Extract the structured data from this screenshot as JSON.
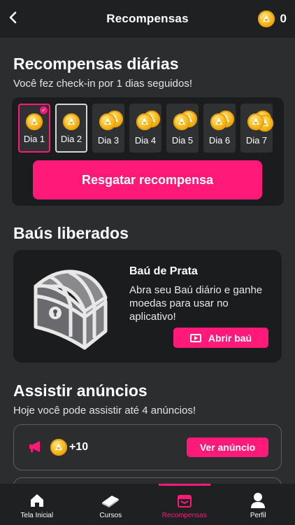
{
  "header": {
    "back_icon": "chevron-left-icon",
    "title": "Recompensas",
    "coin_count": "0"
  },
  "daily": {
    "title": "Recompensas diárias",
    "subtitle": "Você fez check-in por 1 dias seguidos!",
    "days": [
      {
        "label": "Dia 1",
        "state": "checked"
      },
      {
        "label": "Dia 2",
        "state": "current"
      },
      {
        "label": "Dia 3",
        "state": "locked"
      },
      {
        "label": "Dia 4",
        "state": "locked"
      },
      {
        "label": "Dia 5",
        "state": "locked"
      },
      {
        "label": "Dia 6",
        "state": "locked"
      },
      {
        "label": "Dia 7",
        "state": "locked"
      }
    ],
    "claim_button": "Resgatar recompensa"
  },
  "chests": {
    "title": "Baús liberados",
    "chest_name": "Baú de Prata",
    "chest_desc": "Abra seu Baú diário e ganhe moedas para usar no aplicativo!",
    "open_button": "Abrir baú"
  },
  "ads": {
    "title": "Assistir anúncios",
    "subtitle": "Hoje você pode assistir até 4 anúncios!",
    "reward": "+10",
    "watch_button": "Ver anúncio"
  },
  "nav": {
    "items": [
      {
        "label": "Tela Inicial",
        "icon": "home-icon"
      },
      {
        "label": "Cursos",
        "icon": "book-icon"
      },
      {
        "label": "Recompensas",
        "icon": "gift-icon"
      },
      {
        "label": "Perfil",
        "icon": "user-icon"
      }
    ],
    "active": "Recompensas"
  },
  "colors": {
    "accent": "#ff1a7a",
    "background": "#2b2d2e",
    "card": "#1b1c1d",
    "coin": "#f6b81a"
  }
}
